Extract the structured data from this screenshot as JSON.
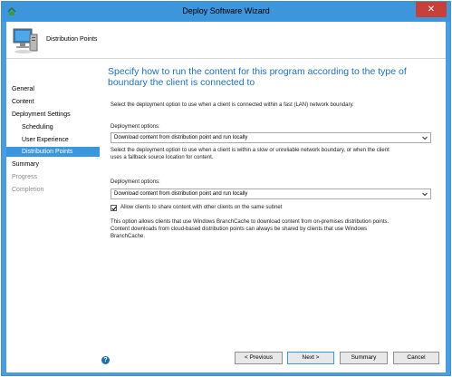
{
  "window": {
    "title": "Deploy Software Wizard",
    "close_glyph": "✕"
  },
  "header": {
    "title": "Distribution Points",
    "icon": "computer-monitor-icon"
  },
  "nav": {
    "items": [
      {
        "label": "General",
        "state": "normal"
      },
      {
        "label": "Content",
        "state": "normal"
      },
      {
        "label": "Deployment Settings",
        "state": "normal"
      },
      {
        "label": "Scheduling",
        "state": "normal"
      },
      {
        "label": "User Experience",
        "state": "normal"
      },
      {
        "label": "Distribution Points",
        "state": "selected"
      },
      {
        "label": "Summary",
        "state": "normal"
      },
      {
        "label": "Progress",
        "state": "disabled"
      },
      {
        "label": "Completion",
        "state": "disabled"
      }
    ]
  },
  "main": {
    "title": "Specify how to run the content for this program according to the type of boundary the client is connected to",
    "fast_desc": "Select the deployment option to use when a client is connected within a fast (LAN) network boundary.",
    "deploy_label_1": "Deployment options:",
    "deploy_value_1": "Download content from distribution point and run locally",
    "slow_desc_line1": "Select the deployment option to use when a client is within a slow or unreliable network boundary, or when the client",
    "slow_desc_line2": "uses a fallback source location for content.",
    "deploy_label_2": "Deployment options:",
    "deploy_value_2": "Download content from distribution point and run locally",
    "share_label": "Allow clients to share content with other clients on the same subnet",
    "share_checked": true,
    "branchcache_line1": "This option allows clients that use Windows BranchCache to download content from on-premises distribution points.",
    "branchcache_line2": "Content downloads from cloud-based distribution points can always be shared by clients that use Windows",
    "branchcache_line3": "BranchCache."
  },
  "footer": {
    "help_glyph": "?",
    "previous": "< Previous",
    "next": "Next >",
    "summary": "Summary",
    "cancel": "Cancel"
  },
  "colors": {
    "accent": "#3a96dd",
    "title_blue": "#1f6fb5",
    "titlebar": "#3d95dc",
    "close": "#c7403a"
  }
}
